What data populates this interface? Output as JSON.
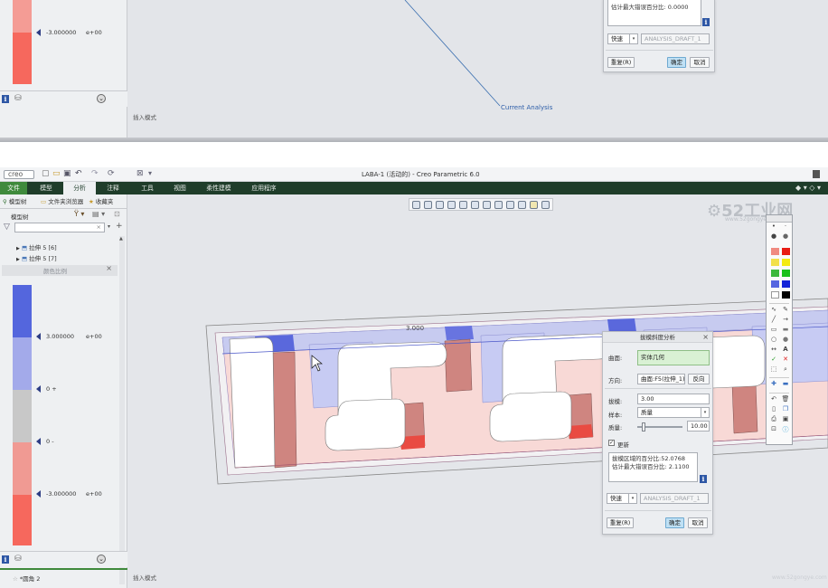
{
  "top": {
    "scale_label": "-3.000000",
    "scale_exp": "e+00",
    "leader_label": "Current Analysis",
    "mode_label": "插入模式",
    "dialog": {
      "result_line": "估计最大错误百分比: 0.0000",
      "speed": "快速",
      "analysis_name": "ANALYSIS_DRAFT_1",
      "reset": "重复(R)",
      "ok": "确定",
      "cancel": "取消"
    }
  },
  "app": {
    "brand": "creo",
    "window_title": "LABA-1 (活动的) - Creo Parametric 6.0",
    "ribbon_tabs": [
      {
        "label": "文件"
      },
      {
        "label": "模型"
      },
      {
        "label": "分析"
      },
      {
        "label": "注释"
      },
      {
        "label": "工具"
      },
      {
        "label": "视图"
      },
      {
        "label": "柔性建模"
      },
      {
        "label": "应用程序"
      }
    ],
    "left_tabs": [
      "模型树",
      "文件夹浏览器",
      "收藏夹"
    ],
    "tree_header": "模型树",
    "tree_items": [
      "拉伸 5 [6]",
      "拉伸 5 [7]"
    ],
    "color_scale_title": "颜色比例",
    "scale_labels": [
      "3.000000",
      "0 +",
      "0 -",
      "-3.000000"
    ],
    "scale_exp": "e+00",
    "footer_item": "*圆角 2",
    "mode_label": "插入模式",
    "dimension": "3.000",
    "watermark_main": "52工业网",
    "watermark_sub": "www.52gongye.com"
  },
  "dialog": {
    "title": "拔模斜度分析",
    "surface_label": "曲面:",
    "surface_value": "实体几何",
    "direction_label": "方向:",
    "direction_value": "曲面:F5(拉伸_1)",
    "reverse_btn": "反向",
    "draft_label": "拔模:",
    "draft_value": "3.00",
    "sample_label": "样本:",
    "sample_value": "质量",
    "quality_label": "质量:",
    "quality_value": "10.00",
    "quality_fraction": 0.1,
    "update_label": "更新",
    "result_1": "拔模区域的百分比:52.0768",
    "result_2": "估计最大错误百分比: 2.1100",
    "speed": "快速",
    "analysis_name": "ANALYSIS_DRAFT_1",
    "reset": "重复(R)",
    "ok": "确定",
    "cancel": "取消"
  },
  "colors": {
    "ribbon_bg": "#1f3d2a",
    "ribbon_file": "#3f8a3c",
    "scale_blue": "#5b6fe0",
    "scale_gray": "#c8c8c8",
    "scale_red": "#f3665c",
    "accent_blue": "#2e57a5"
  }
}
